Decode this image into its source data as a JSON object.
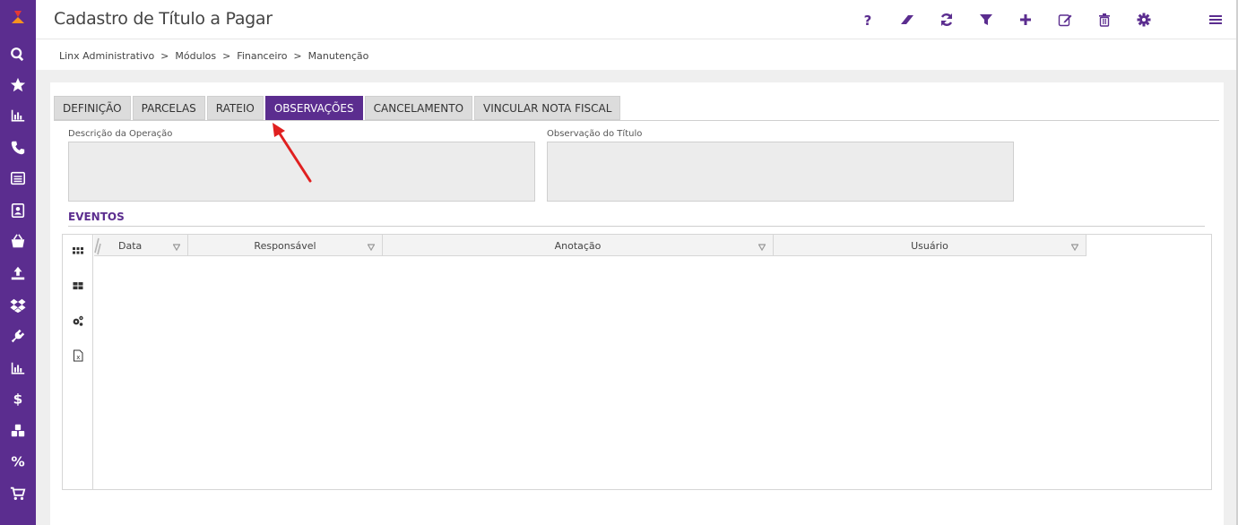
{
  "header": {
    "title": "Cadastro de Título a Pagar",
    "tools": [
      "help-icon",
      "eraser-icon",
      "refresh-icon",
      "filter-icon",
      "plus-icon",
      "edit-icon",
      "trash-icon",
      "gear-icon",
      "menu-icon"
    ]
  },
  "breadcrumb": {
    "items": [
      "Linx Administrativo",
      "Módulos",
      "Financeiro",
      "Manutenção"
    ],
    "separator": ">",
    "text": "Linx Administrativo  >  Módulos  >  Financeiro  >  Manutenção"
  },
  "sidebar": {
    "items": [
      "logo-icon",
      "search-icon",
      "star-icon",
      "bar-chart-icon",
      "phone-icon",
      "list-icon",
      "contact-icon",
      "basket-icon",
      "upload-icon",
      "dropbox-icon",
      "plug-icon",
      "bar-chart-icon",
      "dollar-icon",
      "cubes-icon",
      "percent-icon",
      "cart-icon"
    ]
  },
  "tabs": [
    {
      "label": "DEFINIÇÃO",
      "active": false
    },
    {
      "label": "PARCELAS",
      "active": false
    },
    {
      "label": "RATEIO",
      "active": false
    },
    {
      "label": "OBSERVAÇÕES",
      "active": true
    },
    {
      "label": "CANCELAMENTO",
      "active": false
    },
    {
      "label": "VINCULAR NOTA FISCAL",
      "active": false
    }
  ],
  "form": {
    "descricao_label": "Descrição da Operação",
    "descricao_value": "",
    "observacao_label": "Observação do Título",
    "observacao_value": ""
  },
  "events": {
    "title": "EVENTOS",
    "columns": [
      "Data",
      "Responsável",
      "Anotação",
      "Usuário"
    ],
    "rows": []
  },
  "colors": {
    "brand": "#5b2d8f",
    "annotation_arrow": "#e02020"
  }
}
